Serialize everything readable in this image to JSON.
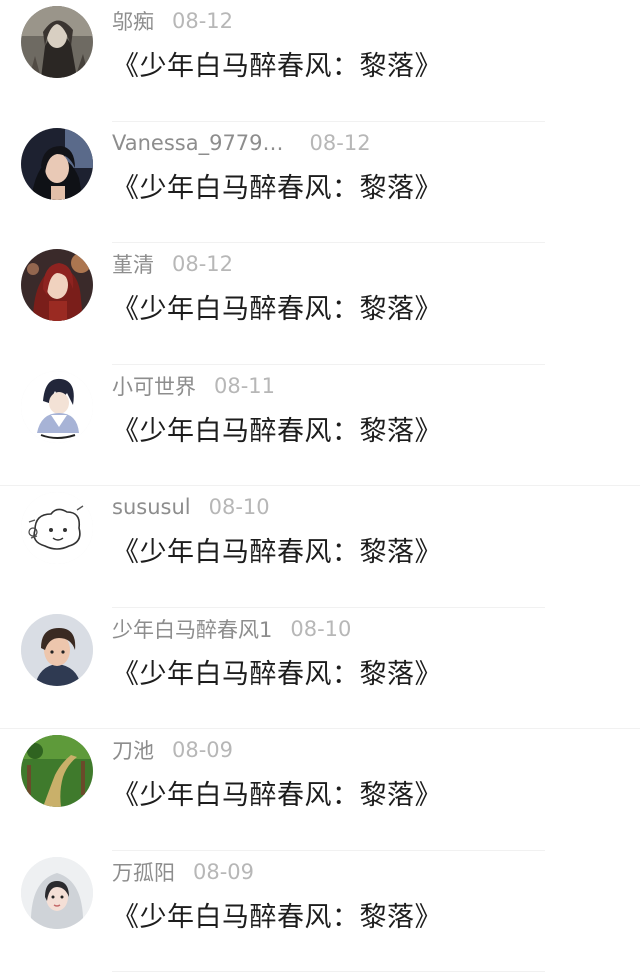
{
  "comments": [
    {
      "username": "邬痴",
      "date": "08-12",
      "content": "《少年白马醉春风：黎落》",
      "avatar_icon": "avatar-dark-fantasy-character-icon"
    },
    {
      "username": "Vanessa_9779…",
      "date": "08-12",
      "content": "《少年白马醉春风：黎落》",
      "avatar_icon": "avatar-woman-portrait-icon"
    },
    {
      "username": "堇清",
      "date": "08-12",
      "content": "《少年白马醉春风：黎落》",
      "avatar_icon": "avatar-red-haired-heroine-icon"
    },
    {
      "username": "小可世界",
      "date": "08-11",
      "content": "《少年白马醉春风：黎落》",
      "avatar_icon": "avatar-anime-boy-icon"
    },
    {
      "username": "sususul",
      "date": "08-10",
      "content": "《少年白马醉春风：黎落》",
      "avatar_icon": "avatar-doodle-icon"
    },
    {
      "username": "少年白马醉春风1",
      "date": "08-10",
      "content": "《少年白马醉春风：黎落》",
      "avatar_icon": "avatar-young-man-icon"
    },
    {
      "username": "刀池",
      "date": "08-09",
      "content": "《少年白马醉春风：黎落》",
      "avatar_icon": "avatar-garden-path-icon"
    },
    {
      "username": "万孤阳",
      "date": "08-09",
      "content": "《少年白马醉春风：黎落》",
      "avatar_icon": "avatar-hooded-girl-icon"
    }
  ],
  "colors": {
    "username": "#8d8d8d",
    "date": "#b7b7b7",
    "content": "#1d1d1d",
    "separator": "#f1f1f1"
  }
}
